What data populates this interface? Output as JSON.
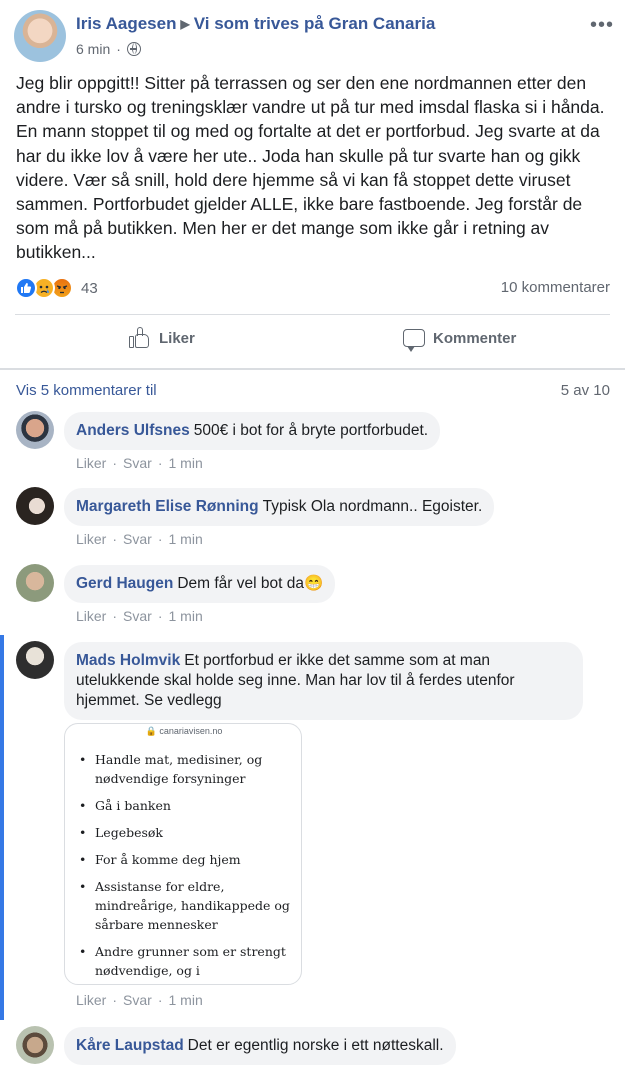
{
  "post": {
    "author": "Iris Aagesen",
    "group": "Vi som trives på Gran Canaria",
    "time": "6 min",
    "text": "Jeg blir oppgitt!! Sitter på terrassen og ser den ene nordmannen etter den andre i tursko og treningsklær vandre ut på tur med imsdal flaska si i hånda. En mann stoppet til og med og fortalte at det er portforbud. Jeg svarte at da har du ikke lov å være her ute.. Joda han skulle på tur svarte han og gikk videre. Vær så snill, hold dere hjemme så vi kan få stoppet dette viruset sammen. Portforbudet gjelder ALLE, ikke bare fastboende. Jeg forstår de som må på butikken. Men her er det mange som ikke går i retning av butikken...",
    "reaction_icons": [
      "like",
      "sad",
      "angry"
    ],
    "reaction_count": "43",
    "comment_count": "10 kommentarer"
  },
  "actions": {
    "like": "Liker",
    "comment": "Kommenter"
  },
  "comments_nav": {
    "more": "Vis 5 kommentarer til",
    "pager": "5 av 10"
  },
  "comment_actions": {
    "like": "Liker",
    "reply": "Svar",
    "dot": "·"
  },
  "comments": [
    {
      "author": "Anders Ulfsnes",
      "text": "500€ i bot for å bryte portforbudet.",
      "time": "1 min"
    },
    {
      "author": "Margareth Elise Rønning",
      "text": "Typisk Ola nordmann.. Egoister.",
      "time": "1 min"
    },
    {
      "author": "Gerd Haugen",
      "text": "Dem får vel bot da😁",
      "time": "1 min"
    },
    {
      "author": "Mads Holmvik",
      "text": "Et portforbud er ikke det samme som at man utelukkende skal holde seg inne. Man har lov til å ferdes utenfor hjemmet. Se vedlegg",
      "time": "1 min"
    },
    {
      "author": "Kåre Laupstad",
      "text": "Det er egentlig norske i ett nøtteskall.",
      "time": ""
    }
  ],
  "attachment": {
    "url": "canariavisen.no",
    "items": [
      "Handle mat, medisiner, og nødvendige forsyninger",
      "Gå i banken",
      "Legebesøk",
      "For å komme deg hjem",
      "Assistanse for eldre, mindreårige, handikappede og sårbare mennesker",
      "Andre grunner som er strengt nødvendige, og i nødsituasjoner."
    ]
  },
  "colors": {
    "link": "#385898",
    "muted": "#616770",
    "bubble": "#f2f3f5",
    "thread": "#3578e5",
    "like_blue": "#2078f4"
  }
}
